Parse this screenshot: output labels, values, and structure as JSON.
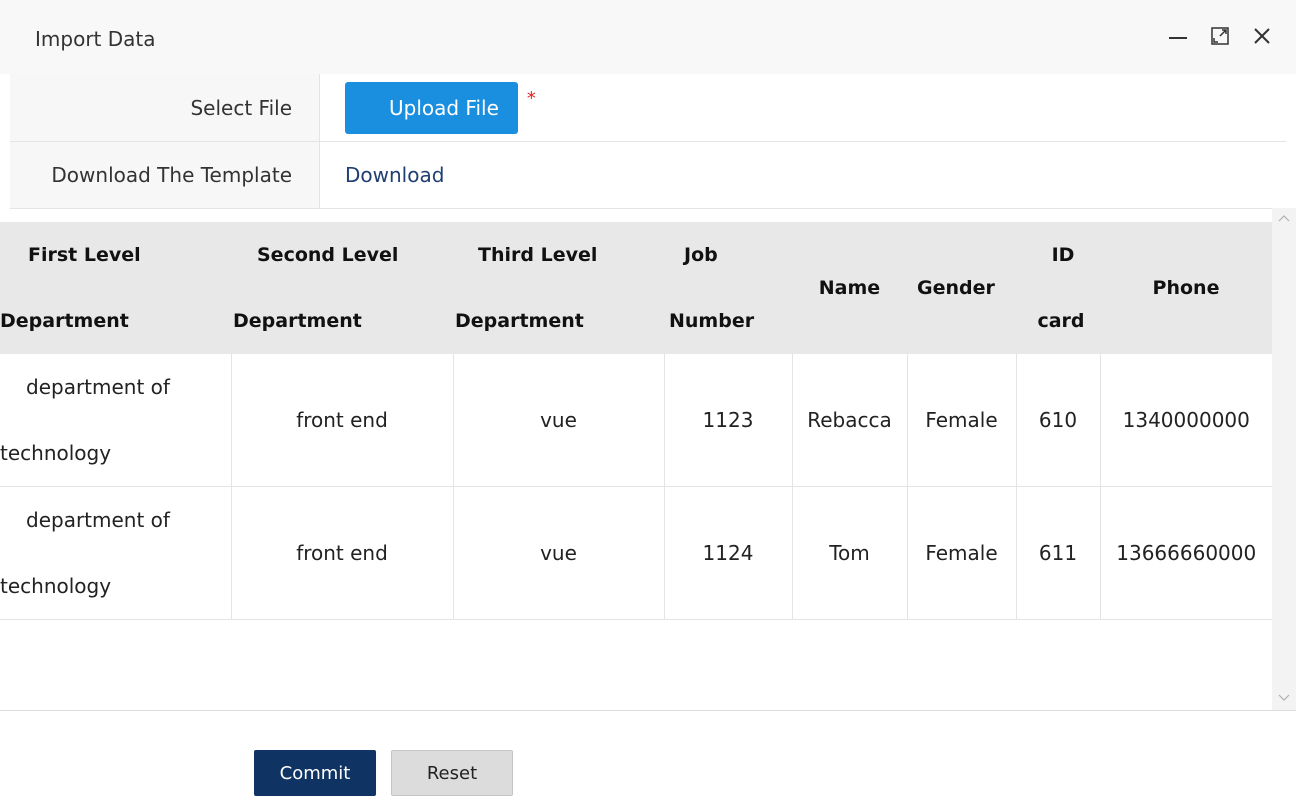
{
  "dialog": {
    "title": "Import Data"
  },
  "form": {
    "select_file_label": "Select File",
    "upload_button": "Upload File",
    "required_mark": "*",
    "download_template_label": "Download The Template",
    "download_link": "Download"
  },
  "table": {
    "headers": [
      {
        "line1": "First Level",
        "line2": "Department"
      },
      {
        "line1": "Second Level",
        "line2": "Department"
      },
      {
        "line1": "Third Level",
        "line2": "Department"
      },
      {
        "line1": "Job",
        "line2": "Number"
      },
      {
        "line1": "Name",
        "line2": ""
      },
      {
        "line1": "Gender",
        "line2": ""
      },
      {
        "line1": "ID",
        "line2": "card"
      },
      {
        "line1": "Phone",
        "line2": ""
      }
    ],
    "rows": [
      {
        "dept1_line1": "department of",
        "dept1_line2": "technology",
        "dept2": "front end",
        "dept3": "vue",
        "job_number": "1123",
        "name": "Rebacca",
        "gender": "Female",
        "id_card": "610",
        "phone": "1340000000"
      },
      {
        "dept1_line1": "department of",
        "dept1_line2": "technology",
        "dept2": "front end",
        "dept3": "vue",
        "job_number": "1124",
        "name": "Tom",
        "gender": "Female",
        "id_card": "611",
        "phone": "13666660000"
      }
    ]
  },
  "footer": {
    "commit_label": "Commit",
    "reset_label": "Reset"
  }
}
